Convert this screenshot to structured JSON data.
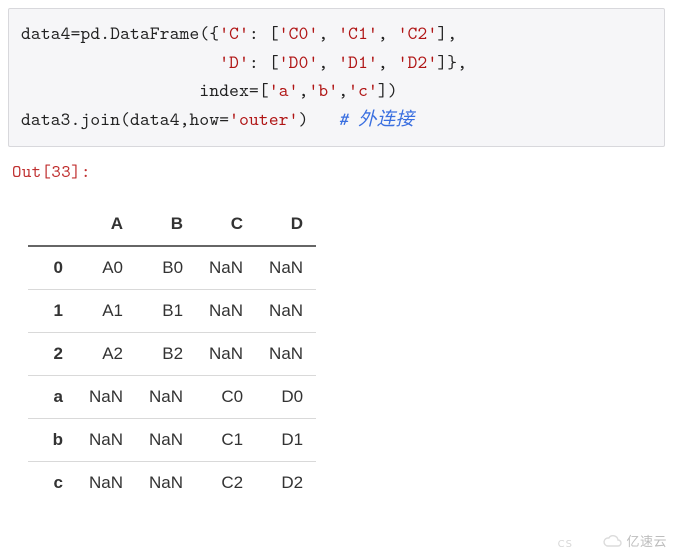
{
  "code": {
    "l1a": "data4=pd.DataFrame({",
    "s_C": "'C'",
    "colon1": ": [",
    "s_C0": "'C0'",
    "cma1": ", ",
    "s_C1": "'C1'",
    "cma2": ", ",
    "s_C2": "'C2'",
    "close1": "],",
    "indent2": "                    ",
    "s_D": "'D'",
    "colon2": ": [",
    "s_D0": "'D0'",
    "cma3": ", ",
    "s_D1": "'D1'",
    "cma4": ", ",
    "s_D2": "'D2'",
    "close2": "]},",
    "indent3": "                  index=[",
    "s_a": "'a'",
    "cma5": ",",
    "s_b": "'b'",
    "cma6": ",",
    "s_c": "'c'",
    "close3": "])",
    "l4a": "data3.join(data4,how=",
    "s_outer": "'outer'",
    "l4b": ")   ",
    "comment": "# 外连接"
  },
  "out_prompt": "Out[33]:",
  "table": {
    "columns": [
      "A",
      "B",
      "C",
      "D"
    ],
    "index": [
      "0",
      "1",
      "2",
      "a",
      "b",
      "c"
    ],
    "rows": [
      [
        "A0",
        "B0",
        "NaN",
        "NaN"
      ],
      [
        "A1",
        "B1",
        "NaN",
        "NaN"
      ],
      [
        "A2",
        "B2",
        "NaN",
        "NaN"
      ],
      [
        "NaN",
        "NaN",
        "C0",
        "D0"
      ],
      [
        "NaN",
        "NaN",
        "C1",
        "D1"
      ],
      [
        "NaN",
        "NaN",
        "C2",
        "D2"
      ]
    ]
  },
  "watermark": "亿速云",
  "cs_tag": "CS"
}
